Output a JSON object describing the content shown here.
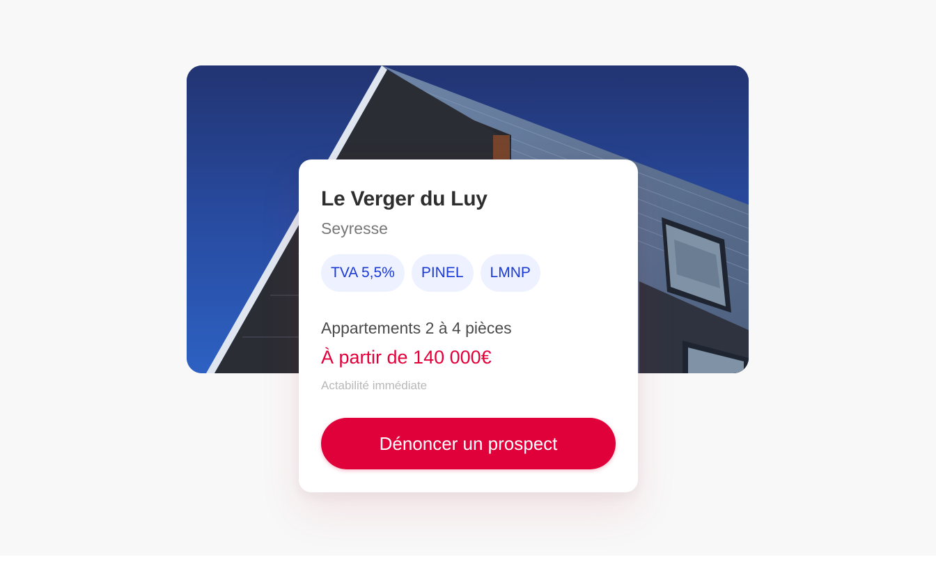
{
  "program": {
    "title": "Le Verger du Luy",
    "city": "Seyresse",
    "tags": [
      "TVA 5,5%",
      "PINEL",
      "LMNP"
    ],
    "rooms": "Appartements 2 à 4 pièces",
    "price": "À partir de 140 000€",
    "availability": "Actabilité immédiate",
    "cta_label": "Dénoncer un prospect"
  },
  "colors": {
    "accent": "#e0003a",
    "tag_text": "#1a3ad6",
    "tag_bg": "#eef1ff",
    "sky": "#2a4fa6"
  }
}
